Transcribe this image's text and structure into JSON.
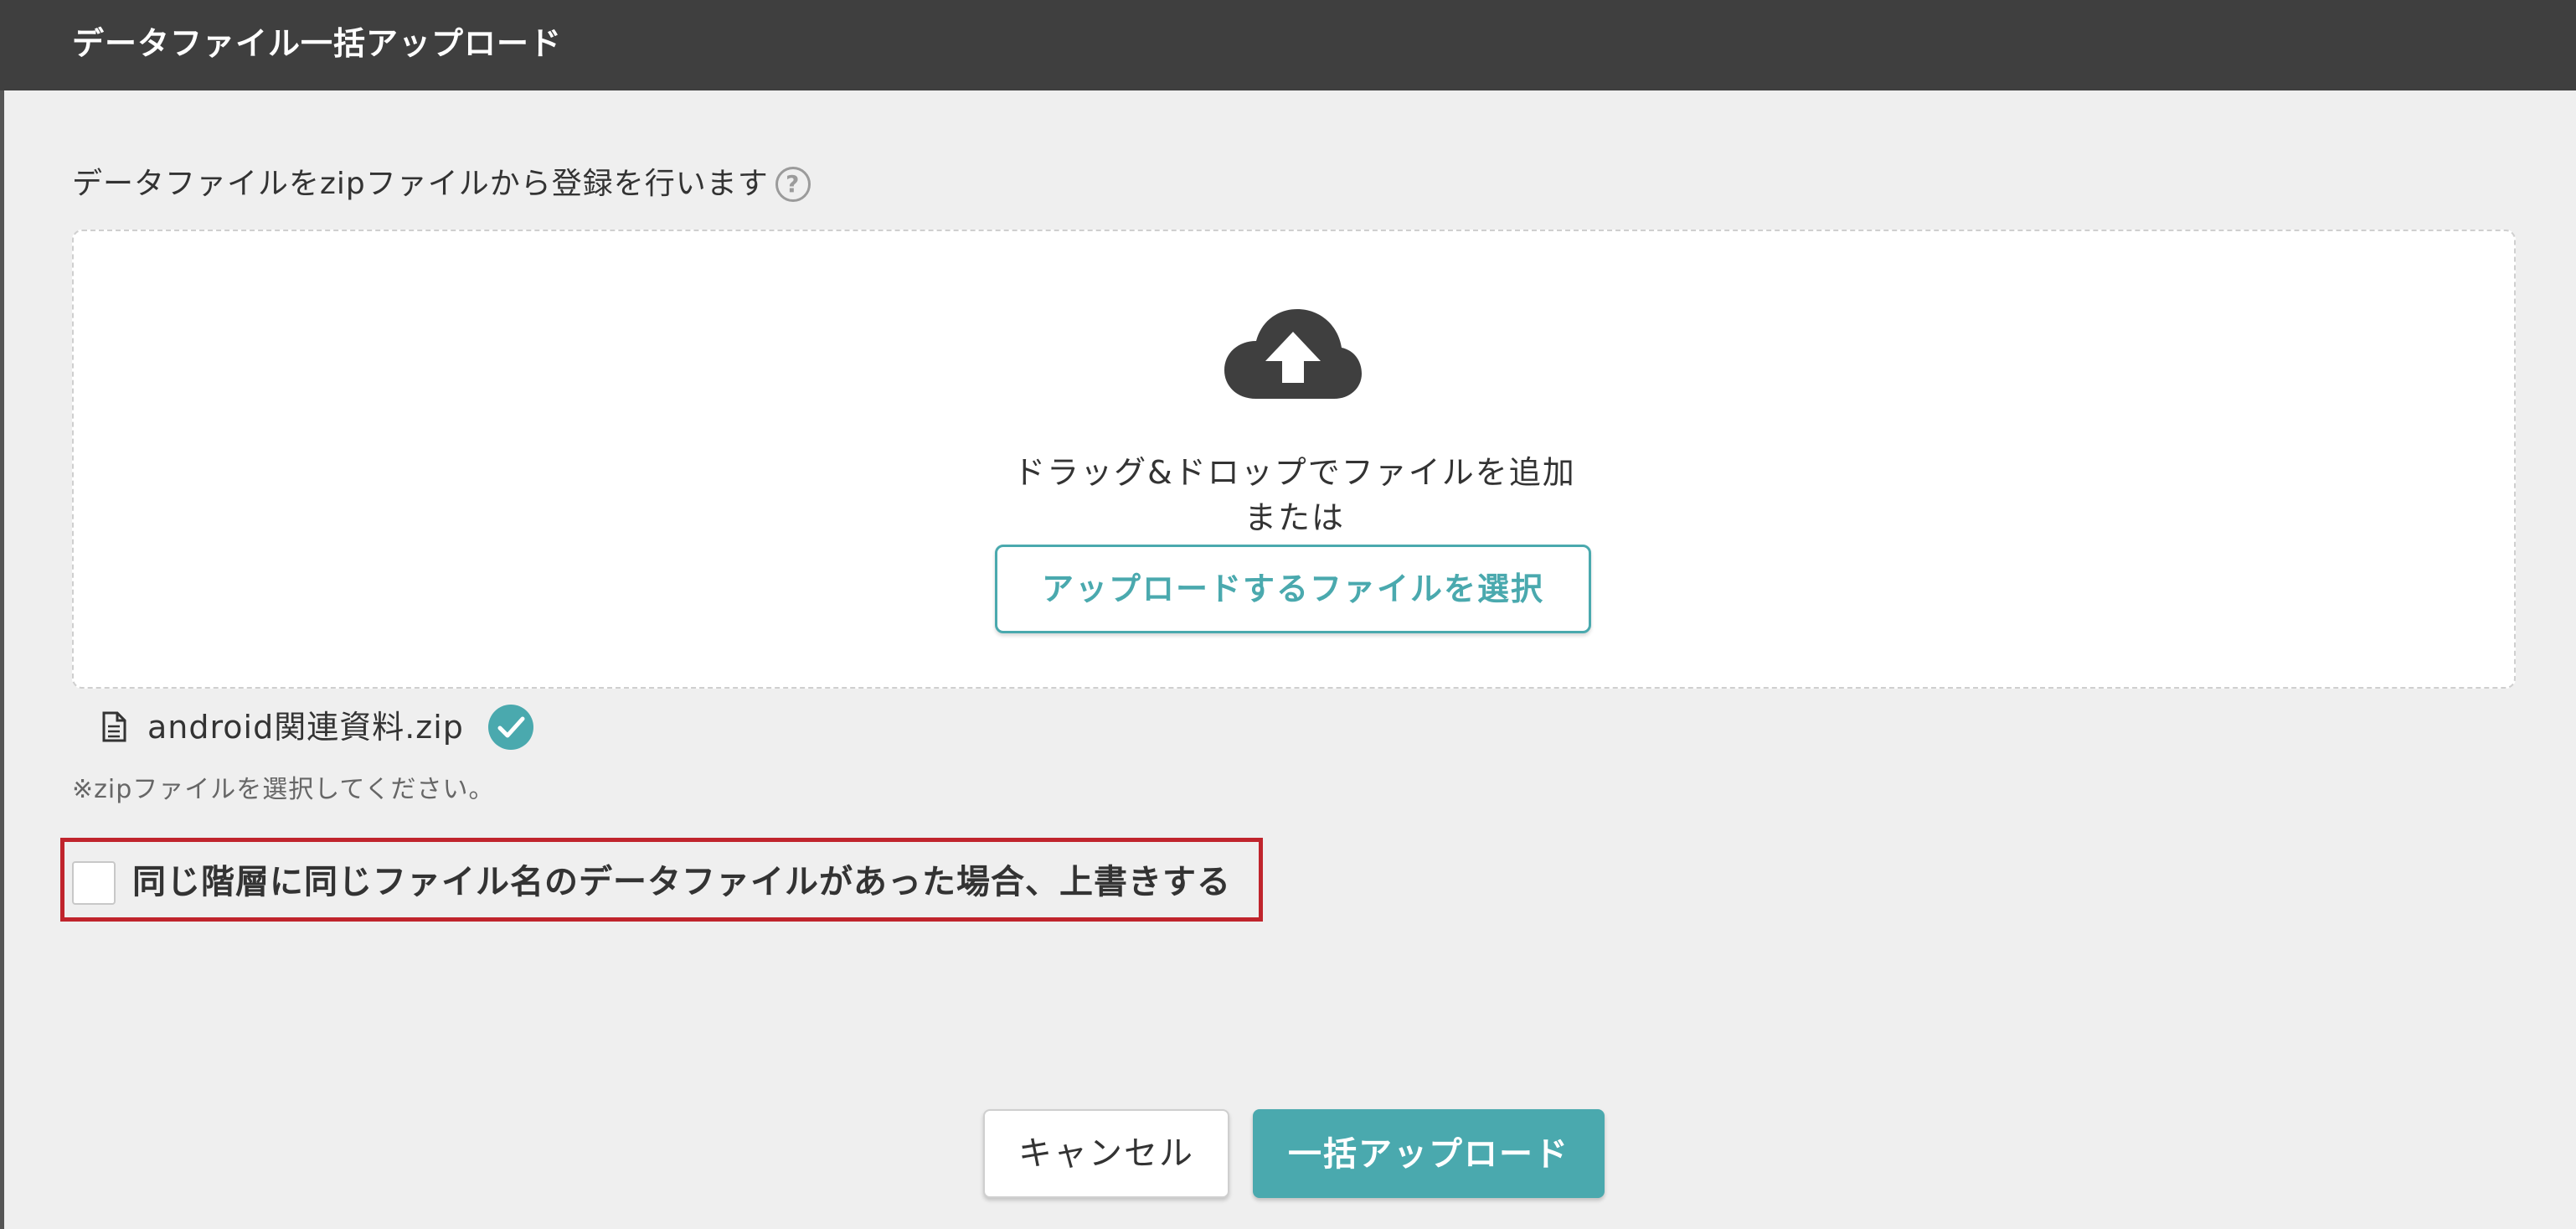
{
  "dialog": {
    "title": "データファイル一括アップロード"
  },
  "form": {
    "description": "データファイルをzipファイルから登録を行います",
    "help_icon": "?",
    "drop_zone": {
      "drag_text": "ドラッグ&ドロップでファイルを追加",
      "or_text": "または",
      "select_button_label": "アップロードするファイルを選択"
    },
    "selected_file": {
      "name": "android関連資料.zip"
    },
    "note": "※zipファイルを選択してください。",
    "overwrite_option": {
      "label": "同じ階層に同じファイル名のデータファイルがあった場合、上書きする",
      "checked": false
    }
  },
  "buttons": {
    "cancel": "キャンセル",
    "upload": "一括アップロード"
  },
  "colors": {
    "header_bg": "#3f3f3f",
    "accent": "#4aa9ae",
    "highlight_border": "#c0242c"
  },
  "icons": {
    "upload": "cloud-upload-icon",
    "file": "document-icon",
    "success": "check-circle-icon",
    "help": "question-circle-icon"
  }
}
